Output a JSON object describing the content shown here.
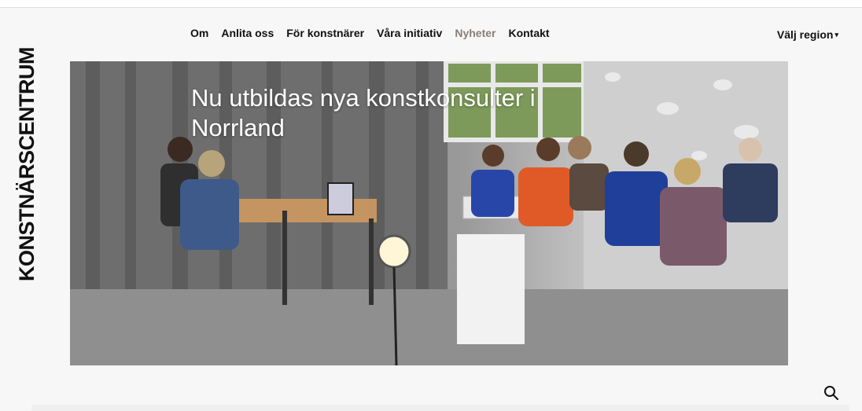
{
  "logo": {
    "text": "KONSTNÄRSCENTRUM"
  },
  "nav": {
    "items": [
      {
        "label": "Om",
        "active": false
      },
      {
        "label": "Anlita oss",
        "active": false
      },
      {
        "label": "För konstnärer",
        "active": false
      },
      {
        "label": "Våra initiativ",
        "active": false
      },
      {
        "label": "Nyheter",
        "active": true
      },
      {
        "label": "Kontakt",
        "active": false
      }
    ],
    "active_color": "#8a7f78"
  },
  "region": {
    "label": "Välj region",
    "icon": "chevron-down-icon"
  },
  "hero": {
    "title": "Nu utbildas nya konstkonsulter i Norrland"
  },
  "search": {
    "icon": "search-icon"
  }
}
